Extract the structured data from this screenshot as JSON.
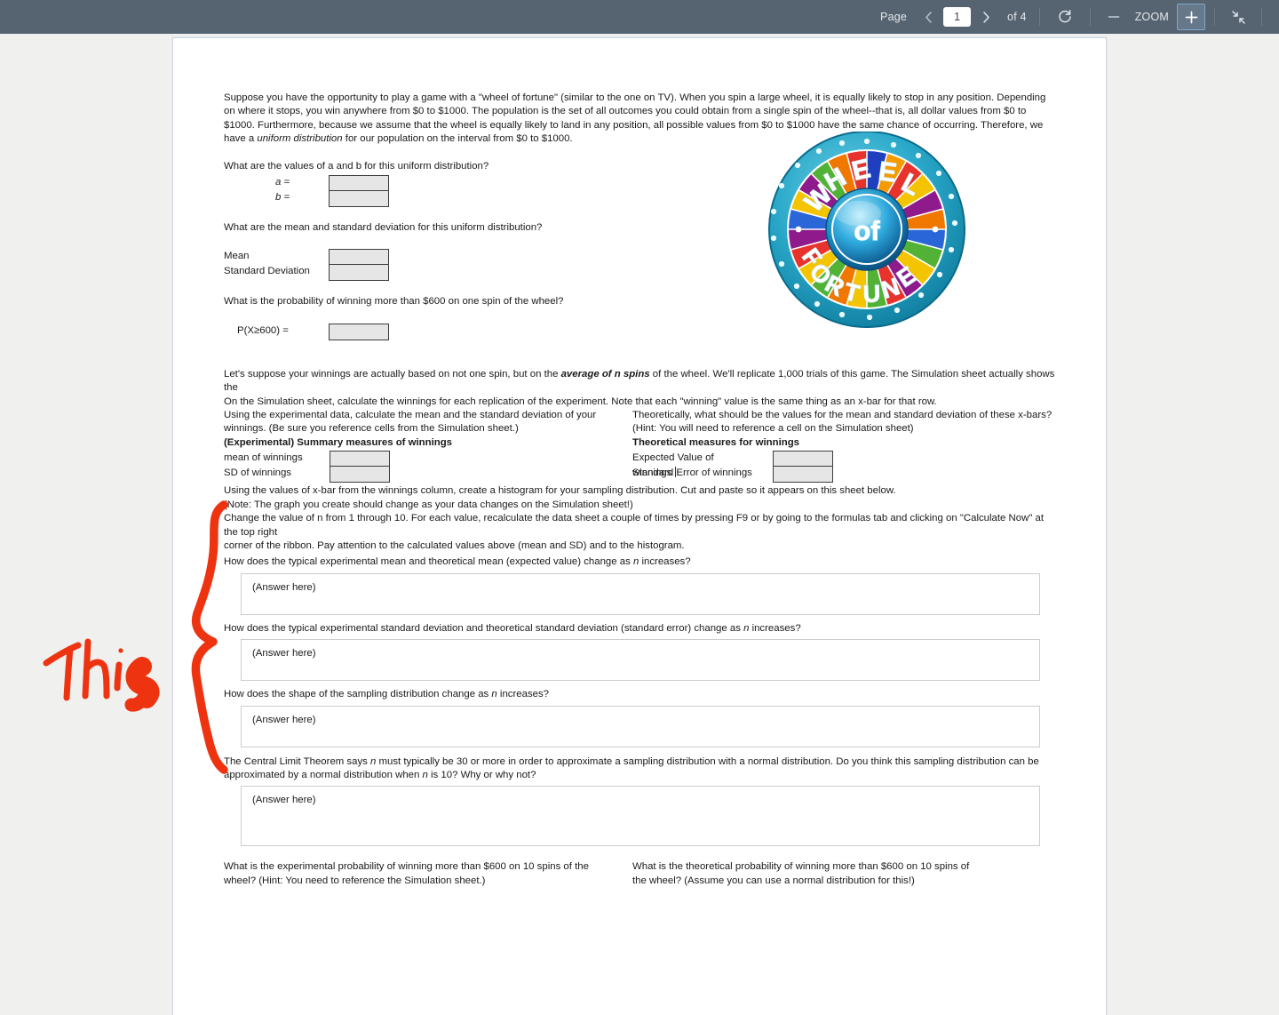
{
  "toolbar": {
    "page_label": "Page",
    "page_value": "1",
    "page_total": "of 4",
    "zoom_label": "ZOOM",
    "prev_icon": "chevron-left-icon",
    "next_icon": "chevron-right-icon",
    "rotate_icon": "rotate-icon",
    "zoom_out_icon": "minus-icon",
    "zoom_in_icon": "plus-icon",
    "fullscreen_icon": "collapse-arrows-icon",
    "bg_color": "#566371",
    "highlight_color": "#7fa8c9"
  },
  "document": {
    "intro": "Suppose you have the opportunity to play a game with a \"wheel of fortune\" (similar to the one on TV).  When you spin a large wheel, it is equally likely to stop in any position.  Depending on where it stops, you win anywhere from $0 to $1000.  The population is the set of all outcomes you could obtain from a single spin of the wheel--that is, all dollar values from $0 to $1000.   Furthermore, because we assume that the wheel is equally likely to land in any position, all possible values from $0 to $1000 have the same chance of occurring.  Therefore, we have a ",
    "intro_italic": "uniform distribution",
    "intro_tail": " for our population on the interval from $0 to $1000.",
    "q1": "What are the values of a and b for this uniform distribution?",
    "q1_label_a": "a =",
    "q1_label_b": "b =",
    "q2": "What are the mean and standard deviation for this uniform distribution?",
    "q2_label_mean": "Mean",
    "q2_label_sd": "Standard Deviation",
    "q3": "What is the probability of winning more than $600 on one spin of the wheel?",
    "q3_label": "P(X≥600) =",
    "para2_a": " Let's suppose your winnings are actually based on not one spin, but on the ",
    "para2_bi": "average of n spins",
    "para2_b": " of the wheel.  We'll replicate 1,000 trials of this game.  The Simulation sheet actually shows the",
    "para2_line2": "On the Simulation sheet, calculate the winnings for each replication of the experiment.  Note that each \"winning\" value is the same thing as an x-bar for that row.",
    "left_instr_1": "Using the experimental data, calculate the mean and the standard deviation of your",
    "left_instr_2": "winnings.  (Be sure you reference cells from the Simulation sheet.)",
    "left_heading_bold": "(Experimental)",
    "left_heading_rest": " Summary measures of winnings",
    "left_lbl_1": "mean of winnings",
    "left_lbl_2": "SD of winnings",
    "right_instr_1": "Theoretically, what should be the values for the mean and standard deviation of these x-bars?",
    "right_instr_2": "(Hint:  You will need to reference a cell on the Simulation sheet)",
    "right_heading": "Theoretical measures for winnings",
    "right_lbl_1": "Expected Value of winnings",
    "right_lbl_2": "Standard Error of winnings",
    "instr_hist_1": "Using the values of x-bar from the winnings column, create a histogram for your sampling distribution.  Cut and paste so it appears on this sheet below.",
    "instr_hist_2": "(Note:  The graph you create should change as your data changes on the Simulation sheet!)",
    "instr_hist_3": "Change the value of n from 1 through 10.  For each value, recalculate the data sheet a couple of times by pressing F9 or by going to the formulas tab and clicking on \"Calculate Now\"  at the top right",
    "instr_hist_4": "corner of the ribbon.  Pay attention to the calculated values above (mean and SD) and to the histogram.",
    "qa1_a": "How does the typical experimental mean and theoretical mean (expected value) change as ",
    "qa1_i": "n",
    "qa1_b": " increases?",
    "qa2_a": "How does the typical experimental standard deviation and theoretical standard deviation (standard error) change as ",
    "qa2_i": "n",
    "qa2_b": " increases?",
    "qa3_a": "How does the shape of the sampling distribution change as ",
    "qa3_i": "n",
    "qa3_b": " increases?",
    "qa4_a": "The Central Limit Theorem says ",
    "qa4_i1": "n",
    "qa4_b": " must typically be 30 or more in order to approximate a sampling distribution with a normal distribution.  Do you think this sampling distribution can be",
    "qa4_line2_a": "approximated by a normal distribution when ",
    "qa4_i2": "n",
    "qa4_line2_b": " is 10?  Why or why not?",
    "answer_placeholder": "(Answer here)",
    "bottom_left_1": "What is the experimental probability of winning more than $600 on 10 spins of the",
    "bottom_left_2": "wheel?  (Hint:  You need to reference the Simulation sheet.)",
    "bottom_right_1": "What is the theoretical probability of winning more than $600 on 10 spins of",
    "bottom_right_2": "the wheel?  (Assume you can use a normal distribution for this!)"
  },
  "wheel": {
    "alt": "wheel-of-fortune-logo",
    "text_line_1": "WHEEL",
    "text_center": "of",
    "text_line_2": "FORTUNE"
  },
  "annotation": {
    "text": "This",
    "color": "#ee3311",
    "shape": "brace-bracket"
  }
}
